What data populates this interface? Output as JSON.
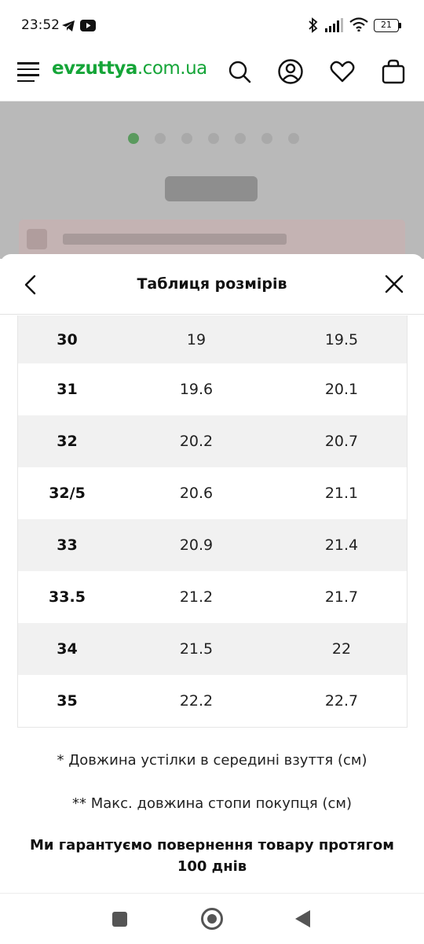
{
  "status_bar": {
    "time": "23:52",
    "battery": "21"
  },
  "header": {
    "logo_brand": "evzuttya",
    "logo_domain": ".com.ua"
  },
  "sheet": {
    "title": "Таблиця розмірів"
  },
  "size_table": {
    "rows": [
      {
        "size": "30",
        "insole": "19",
        "foot": "19.5"
      },
      {
        "size": "31",
        "insole": "19.6",
        "foot": "20.1"
      },
      {
        "size": "32",
        "insole": "20.2",
        "foot": "20.7"
      },
      {
        "size": "32/5",
        "insole": "20.6",
        "foot": "21.1"
      },
      {
        "size": "33",
        "insole": "20.9",
        "foot": "21.4"
      },
      {
        "size": "33.5",
        "insole": "21.2",
        "foot": "21.7"
      },
      {
        "size": "34",
        "insole": "21.5",
        "foot": "22"
      },
      {
        "size": "35",
        "insole": "22.2",
        "foot": "22.7"
      }
    ]
  },
  "notes": {
    "insole_note": "* Довжина устілки в середині взуття (см)",
    "foot_note": "** Макс. довжина стопи покупця (см)",
    "guarantee": "Ми гарантуємо повернення товару протягом 100 днів"
  },
  "colors": {
    "brand_green": "#15a538",
    "row_shade": "#f1f1f1",
    "overlay": "#b9b9b9"
  },
  "icons": [
    "telegram-icon",
    "youtube-icon",
    "bluetooth-icon",
    "signal-icon",
    "wifi-icon",
    "battery-icon",
    "menu-icon",
    "search-icon",
    "account-icon",
    "heart-icon",
    "bag-icon",
    "back-arrow-icon",
    "close-icon"
  ]
}
